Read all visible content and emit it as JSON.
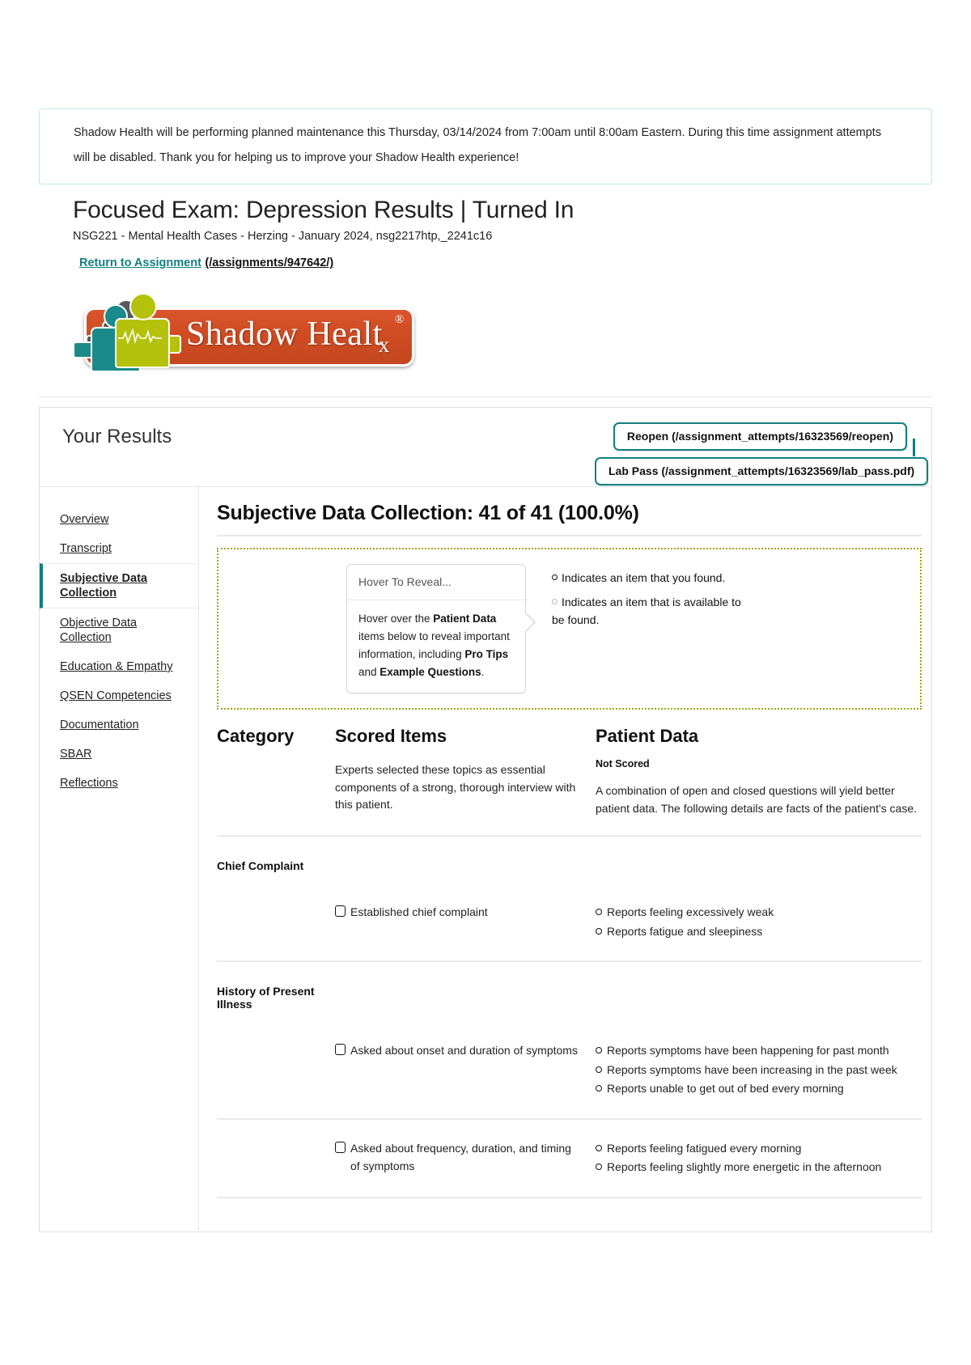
{
  "banner": {
    "text": "Shadow Health will be performing planned maintenance this Thursday, 03/14/2024 from 7:00am until 8:00am Eastern. During this time assignment attempts will be disabled. Thank you for helping us to improve your Shadow Health experience!"
  },
  "header": {
    "title": "Focused Exam: Depression Results | Turned In",
    "subtitle": "NSG221 - Mental Health Cases - Herzing - January 2024, nsg2217htp,_2241c16",
    "return_link_label": "Return to Assignment",
    "return_link_path": "(/assignments/947642/)"
  },
  "logo": {
    "wordmark": "Shadow Healt",
    "wordmark_sub": "x",
    "registered": "®",
    "plate_color": "#cf4b22",
    "figure_colors": [
      "#58595b",
      "#1a8a8a",
      "#b5c20c"
    ]
  },
  "panel": {
    "heading": "Your Results",
    "reopen_button": "Reopen (/assignment_attempts/16323569/reopen)",
    "lab_pass_button": "Lab Pass (/assignment_attempts/16323569/lab_pass.pdf)",
    "accent_color": "#127f80"
  },
  "sidebar": {
    "items": [
      {
        "label": "Overview",
        "active": false
      },
      {
        "label": "Transcript",
        "active": false
      },
      {
        "label": "Subjective Data Collection",
        "active": true
      },
      {
        "label": "Objective Data Collection",
        "active": false
      },
      {
        "label": "Education & Empathy",
        "active": false
      },
      {
        "label": "QSEN Competencies",
        "active": false
      },
      {
        "label": "Documentation",
        "active": false
      },
      {
        "label": "SBAR",
        "active": false
      },
      {
        "label": "Reflections",
        "active": false
      }
    ]
  },
  "main": {
    "section_title": "Subjective Data Collection: 41 of 41 (100.0%)",
    "score": {
      "earned": 41,
      "total": 41,
      "percent": "100.0%"
    },
    "reveal": {
      "callout_top": "Hover To Reveal...",
      "callout_body_1": "Hover over the ",
      "callout_body_bold_1": "Patient Data",
      "callout_body_2": " items below to reveal important information, including ",
      "callout_body_bold_2": "Pro Tips",
      "callout_body_3": " and ",
      "callout_body_bold_3": "Example Questions",
      "callout_body_4": ".",
      "legend_found": "Indicates an item that you found.",
      "legend_available": "Indicates an item that is available to be found.",
      "border_color": "#a3a30f"
    },
    "table": {
      "headers": {
        "category": "Category",
        "scored_items": "Scored Items",
        "patient_data": "Patient Data"
      },
      "not_scored_label": "Not Scored",
      "scored_items_intro": "Experts selected these topics as essential components of a strong, thorough interview with this patient.",
      "patient_data_intro": "A combination of open and closed questions will yield better patient data. The following details are facts of the patient's case.",
      "categories": [
        {
          "name": "Chief Complaint",
          "rows": [
            {
              "scored_item": "Established chief complaint",
              "checked": false,
              "patient_data": [
                "Reports feeling excessively weak",
                "Reports fatigue and sleepiness"
              ]
            }
          ]
        },
        {
          "name": "History of Present Illness",
          "rows": [
            {
              "scored_item": "Asked about onset and duration of symptoms",
              "checked": false,
              "patient_data": [
                "Reports symptoms have been happening for past month",
                "Reports symptoms have been increasing in the past week",
                "Reports unable to get out of bed every morning"
              ]
            },
            {
              "scored_item": "Asked about frequency, duration, and timing of symptoms",
              "checked": false,
              "patient_data": [
                "Reports feeling fatigued every morning",
                "Reports feeling slightly more energetic in the afternoon"
              ]
            }
          ]
        }
      ]
    }
  }
}
